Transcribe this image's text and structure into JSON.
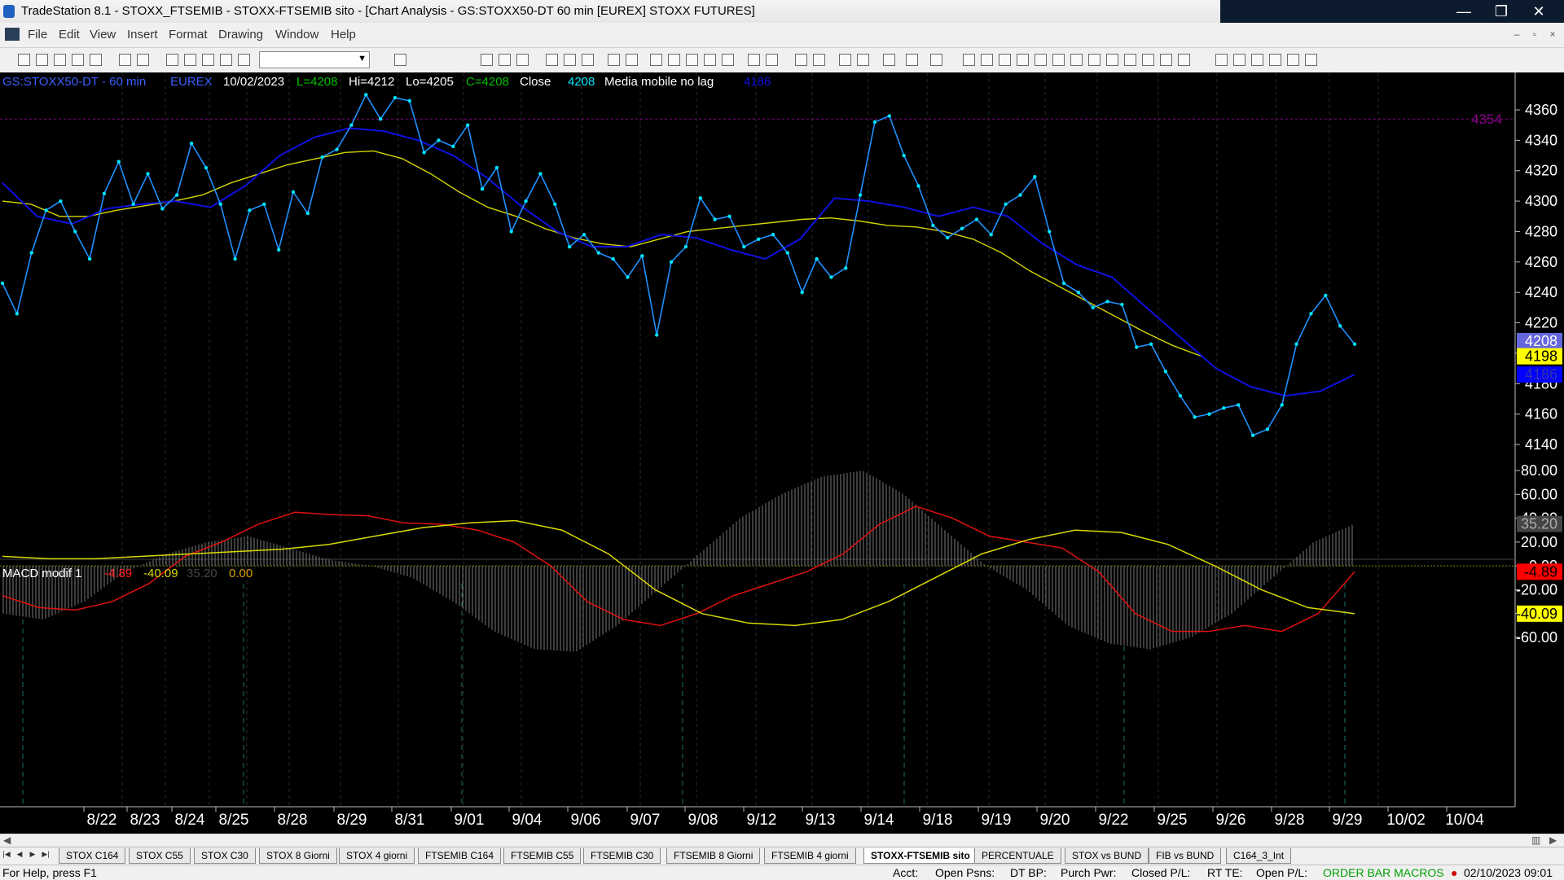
{
  "window": {
    "title": "TradeStation 8.1 - STOXX_FTSEMIB - STOXX-FTSEMIB sito - [Chart Analysis - GS:STOXX50-DT  60 min  [EUREX] STOXX FUTURES]",
    "controls": [
      "—",
      "❐",
      "✕"
    ]
  },
  "menu": {
    "items": [
      "File",
      "Edit",
      "View",
      "Insert",
      "Format",
      "Drawing",
      "Window",
      "Help"
    ],
    "mdi_controls": [
      "–",
      "▫",
      "×"
    ]
  },
  "toolbar": {
    "combo_value": ""
  },
  "chart_header": {
    "symbol": "GS:STOXX50-DT - 60 min",
    "exchange": "EUREX",
    "date": "10/02/2023",
    "last": "L=4208",
    "high": "Hi=4212",
    "low": "Lo=4205",
    "close": "C=4208",
    "close_label": "Close",
    "close_value": "4208",
    "indicator_name": "Media mobile no lag",
    "indicator_value": "4186"
  },
  "price_axis": {
    "ticks": [
      "4360",
      "4340",
      "4320",
      "4300",
      "4280",
      "4260",
      "4240",
      "4220",
      "4200",
      "4180",
      "4160",
      "4140"
    ],
    "level_line_label": "4354",
    "markers": [
      {
        "label": "4208",
        "bg": "#6666dd",
        "fg": "#ffffff"
      },
      {
        "label": "4198",
        "bg": "#ffff00",
        "fg": "#000000"
      },
      {
        "label": "4186",
        "bg": "#0000ff",
        "fg": "#3333aa"
      }
    ]
  },
  "macd_header": {
    "name": "MACD modif 1",
    "v1": "-4.89",
    "v2": "-40.09",
    "v3": "35.20",
    "v4": "0.00"
  },
  "macd_axis": {
    "ticks": [
      "80.00",
      "60.00",
      "40.00",
      "20.00",
      "0.00",
      "-20.00",
      "-40.00",
      "-60.00"
    ],
    "markers": [
      {
        "label": "35.20",
        "bg": "#444444",
        "fg": "#aaaaaa"
      },
      {
        "label": "-4.89",
        "bg": "#ff0000",
        "fg": "#000000"
      },
      {
        "label": "-40.09",
        "bg": "#ffff00",
        "fg": "#000000"
      }
    ]
  },
  "date_axis": [
    "8/22",
    "8/23",
    "8/24",
    "8/25",
    "8/28",
    "8/29",
    "8/31",
    "9/01",
    "9/04",
    "9/06",
    "9/07",
    "9/08",
    "9/12",
    "9/13",
    "9/14",
    "9/18",
    "9/19",
    "9/20",
    "9/22",
    "9/25",
    "9/26",
    "9/28",
    "9/29",
    "10/02",
    "10/04"
  ],
  "colors": {
    "price": "#1e90ff",
    "price_dots": "#00e5ff",
    "ma_yellow": "#d4d400",
    "ma_blue": "#1010e0",
    "macd_red": "#e01010",
    "macd_yellow": "#d8d800",
    "histogram": "#7a7a7a",
    "header_blue": "#3a5fff",
    "header_green": "#00c000"
  },
  "tabs": [
    "STOX C164",
    "STOX C55",
    "STOX  C30",
    "STOX  8 Giorni",
    "STOX 4 giorni",
    "FTSEMIB C164",
    "FTSEMIB C55",
    "FTSEMIB C30",
    "FTSEMIB  8 Giorni",
    "FTSEMIB  4 giorni",
    "STOXX-FTSEMIB sito",
    "PERCENTUALE",
    "STOX vs BUND",
    "FIB vs BUND",
    "C164_3_Int"
  ],
  "active_tab": "STOXX-FTSEMIB sito",
  "status": {
    "help": "For Help, press F1",
    "acct": "Acct:",
    "open_psns": "Open Psns:",
    "dt_bp": "DT BP:",
    "purch_pwr": "Purch Pwr:",
    "closed_pl": "Closed P/L:",
    "rt_te": "RT TE:",
    "open_pl": "Open P/L:",
    "macros": "ORDER BAR  MACROS",
    "datetime": "02/10/2023 09:01"
  },
  "chart_data": [
    {
      "type": "line",
      "series": [
        {
          "name": "Close",
          "values": [
            4246,
            4226,
            4266,
            4294,
            4300,
            4280,
            4262,
            4305,
            4326,
            4298,
            4318,
            4295,
            4304,
            4338,
            4322,
            4298,
            4262,
            4294,
            4298,
            4268,
            4306,
            4292,
            4329,
            4334,
            4350,
            4370,
            4354,
            4368,
            4366,
            4332,
            4340,
            4336,
            4350,
            4308,
            4322,
            4280,
            4300,
            4318,
            4298,
            4270,
            4278,
            4266,
            4262,
            4250,
            4264,
            4212,
            4260,
            4270,
            4302,
            4288,
            4290,
            4270,
            4275,
            4278,
            4266,
            4240,
            4262,
            4250,
            4256,
            4304,
            4352,
            4356,
            4330,
            4310,
            4284,
            4276,
            4282,
            4288,
            4278,
            4298,
            4304,
            4316,
            4280,
            4246,
            4240,
            4230,
            4234,
            4232,
            4204,
            4206,
            4188,
            4172,
            4158,
            4160,
            4164,
            4166,
            4146,
            4150,
            4166,
            4206,
            4226,
            4238,
            4218,
            4206
          ]
        },
        {
          "name": "Media mobile no lag",
          "values": [
            4300,
            4298,
            4290,
            4290,
            4294,
            4297,
            4300,
            4304,
            4312,
            4318,
            4324,
            4328,
            4332,
            4333,
            4328,
            4318,
            4306,
            4296,
            4290,
            4282,
            4276,
            4272,
            4270,
            4275,
            4280,
            4282,
            4284,
            4286,
            4288,
            4289,
            4287,
            4284,
            4283,
            4280,
            4275,
            4266,
            4254,
            4244,
            4234,
            4224,
            4214,
            4205,
            4198
          ]
        },
        {
          "name": "",
          "values": [
            4312,
            4290,
            4285,
            4295,
            4298,
            4300,
            4296,
            4310,
            4330,
            4342,
            4348,
            4346,
            4340,
            4330,
            4315,
            4296,
            4280,
            4270,
            4270,
            4278,
            4276,
            4268,
            4262,
            4275,
            4302,
            4300,
            4296,
            4290,
            4296,
            4290,
            4272,
            4258,
            4250,
            4230,
            4210,
            4190,
            4178,
            4172,
            4175,
            4186
          ]
        }
      ]
    },
    {
      "type": "line",
      "series": [
        {
          "name": "MACD",
          "values": [
            -25,
            -35,
            -37,
            -30,
            -15,
            8,
            20,
            35,
            45,
            43,
            42,
            36,
            35,
            30,
            20,
            0,
            -30,
            -45,
            -50,
            -40,
            -25,
            -15,
            -5,
            10,
            35,
            50,
            40,
            25,
            20,
            15,
            -5,
            -40,
            -55,
            -55,
            -50,
            -55,
            -40,
            -4.89
          ]
        },
        {
          "name": "",
          "values": [
            8,
            6,
            6,
            8,
            10,
            12,
            14,
            18,
            25,
            32,
            36,
            38,
            30,
            10,
            -20,
            -40,
            -48,
            -50,
            -45,
            -30,
            -10,
            10,
            22,
            30,
            28,
            18,
            0,
            -20,
            -35,
            -40.09
          ]
        },
        {
          "name": "",
          "values": [
            -40,
            -45,
            -30,
            -5,
            10,
            20,
            25,
            15,
            5,
            0,
            -10,
            -30,
            -55,
            -70,
            -72,
            -50,
            -20,
            10,
            40,
            60,
            75,
            80,
            60,
            30,
            0,
            -20,
            -50,
            -65,
            -70,
            -60,
            -40,
            -10,
            20,
            35.2
          ]
        }
      ]
    }
  ]
}
